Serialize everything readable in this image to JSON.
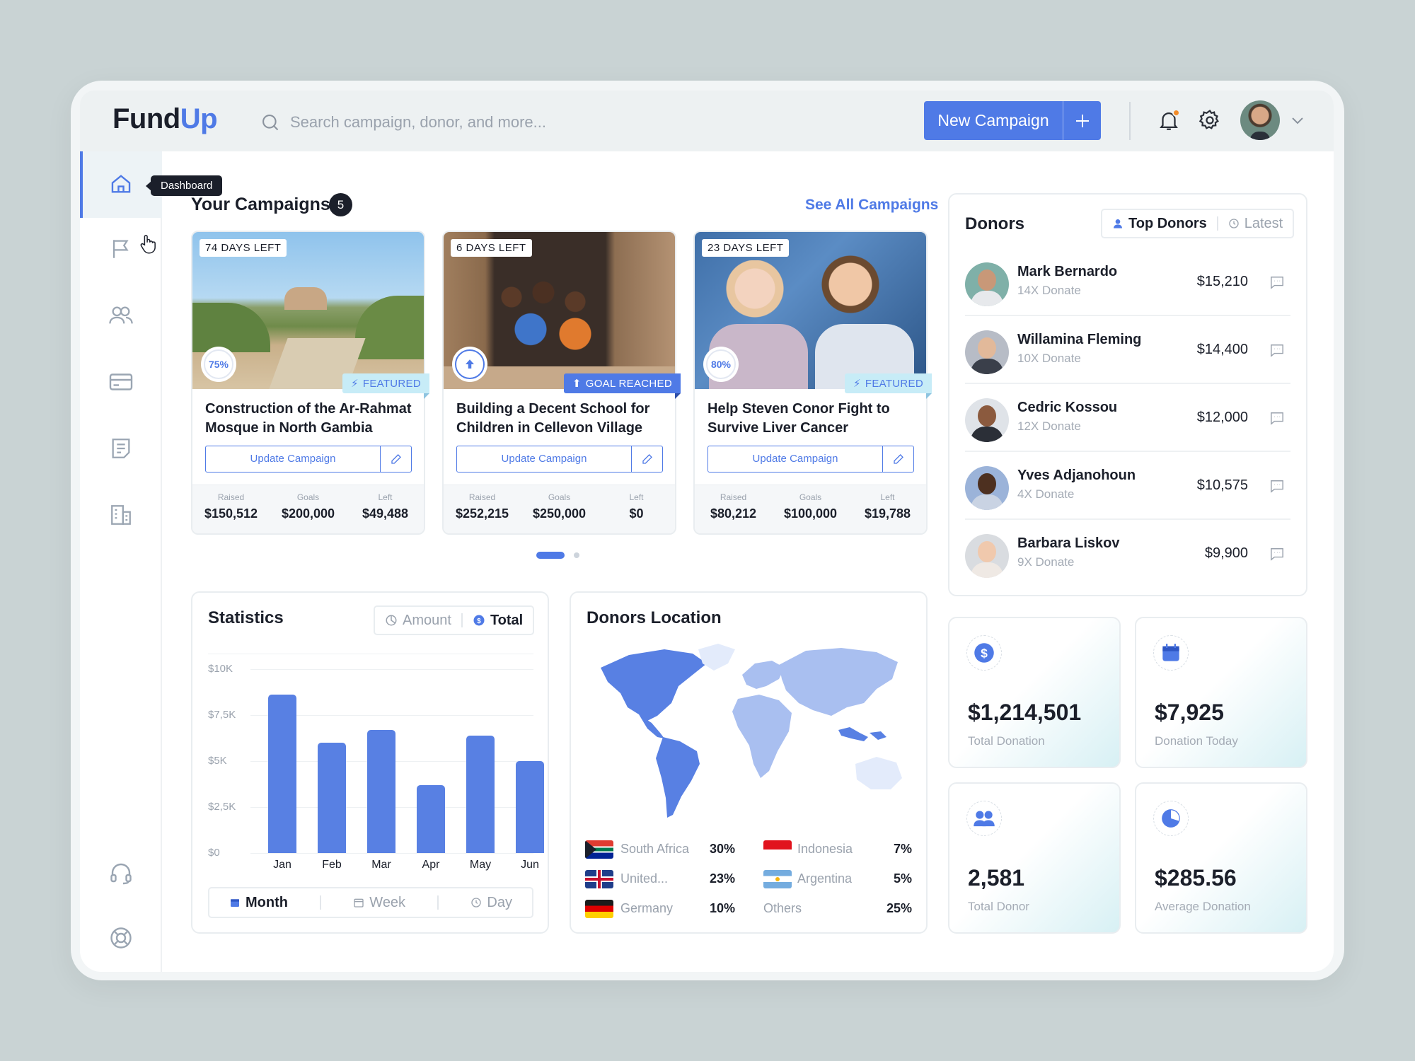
{
  "app": {
    "logo_main": "Fund",
    "logo_accent": "Up"
  },
  "search": {
    "placeholder": "Search campaign, donor, and more..."
  },
  "header": {
    "new_campaign_label": "New Campaign"
  },
  "sidebar": {
    "tooltip": "Dashboard"
  },
  "campaigns": {
    "title": "Your Campaigns",
    "count": "5",
    "see_all": "See All Campaigns",
    "items": [
      {
        "days_left": "74 DAYS LEFT",
        "progress": "75%",
        "badge": "FEATURED",
        "title": "Construction of the Ar-Rahmat Mosque in North Gambia",
        "button": "Update Campaign",
        "raised_label": "Raised",
        "raised": "$150,512",
        "goals_label": "Goals",
        "goals": "$200,000",
        "left_label": "Left",
        "left": "$49,488"
      },
      {
        "days_left": "6 DAYS LEFT",
        "progress": "",
        "badge": "GOAL REACHED",
        "title": "Building a Decent School for Children in Cellevon Village",
        "button": "Update Campaign",
        "raised_label": "Raised",
        "raised": "$252,215",
        "goals_label": "Goals",
        "goals": "$250,000",
        "left_label": "Left",
        "left": "$0"
      },
      {
        "days_left": "23 DAYS LEFT",
        "progress": "80%",
        "badge": "FEATURED",
        "title": "Help Steven Conor Fight to Survive Liver Cancer",
        "button": "Update Campaign",
        "raised_label": "Raised",
        "raised": "$80,212",
        "goals_label": "Goals",
        "goals": "$100,000",
        "left_label": "Left",
        "left": "$19,788"
      }
    ]
  },
  "statistics": {
    "title": "Statistics",
    "toggle": [
      "Amount",
      "Total"
    ],
    "periods": [
      "Month",
      "Week",
      "Day"
    ]
  },
  "chart_data": {
    "type": "bar",
    "categories": [
      "Jan",
      "Feb",
      "Mar",
      "Apr",
      "May",
      "Jun"
    ],
    "values": [
      8600,
      6000,
      6700,
      3700,
      6400,
      5000
    ],
    "yticks": [
      "$10K",
      "$7,5K",
      "$5K",
      "$2,5K",
      "$0"
    ],
    "ylim": [
      0,
      10000
    ],
    "grid": true,
    "color": "#5880e3"
  },
  "location": {
    "title": "Donors Location",
    "items": [
      {
        "name": "South Africa",
        "pct": "30%"
      },
      {
        "name": "United...",
        "pct": "23%"
      },
      {
        "name": "Germany",
        "pct": "10%"
      },
      {
        "name": "Indonesia",
        "pct": "7%"
      },
      {
        "name": "Argentina",
        "pct": "5%"
      },
      {
        "name": "Others",
        "pct": "25%"
      }
    ]
  },
  "donors": {
    "title": "Donors",
    "tabs": [
      "Top Donors",
      "Latest"
    ],
    "items": [
      {
        "name": "Mark Bernardo",
        "times": "14X Donate",
        "amount": "$15,210"
      },
      {
        "name": "Willamina Fleming",
        "times": "10X Donate",
        "amount": "$14,400"
      },
      {
        "name": "Cedric Kossou",
        "times": "12X Donate",
        "amount": "$12,000"
      },
      {
        "name": "Yves Adjanohoun",
        "times": "4X Donate",
        "amount": "$10,575"
      },
      {
        "name": "Barbara Liskov",
        "times": "9X Donate",
        "amount": "$9,900"
      }
    ]
  },
  "kpis": [
    {
      "value": "$1,214,501",
      "label": "Total Donation",
      "icon": "dollar-icon"
    },
    {
      "value": "$7,925",
      "label": "Donation Today",
      "icon": "calendar-icon"
    },
    {
      "value": "2,581",
      "label": "Total Donor",
      "icon": "users-icon"
    },
    {
      "value": "$285.56",
      "label": "Average Donation",
      "icon": "pie-icon"
    }
  ],
  "colors": {
    "accent": "#4f7ae6",
    "bar": "#5880e3",
    "notification": "#f28c28"
  }
}
